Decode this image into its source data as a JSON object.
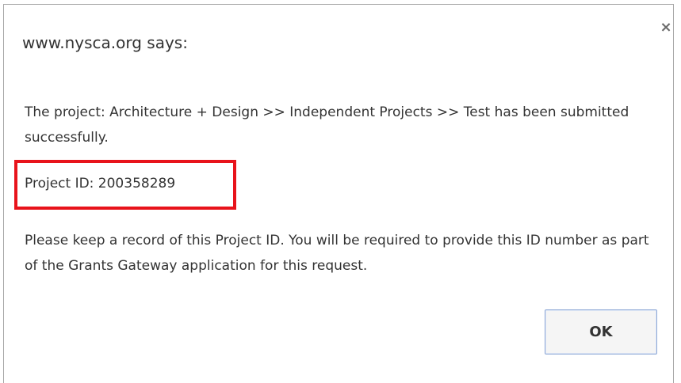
{
  "dialog": {
    "title": "www.nysca.org says:",
    "close_glyph": "×",
    "close_icon": "close-icon",
    "message": "The project: Architecture + Design >> Independent Projects >> Test has been submitted successfully.",
    "project_id_text": "Project ID: 200358289",
    "note": "Please keep a record of this Project ID. You will be required to provide this ID number as part of the Grants Gateway application for this request.",
    "ok_label": "OK"
  },
  "colors": {
    "highlight_border": "#e8131b",
    "button_border": "#8fa9d6",
    "text": "#333333"
  }
}
